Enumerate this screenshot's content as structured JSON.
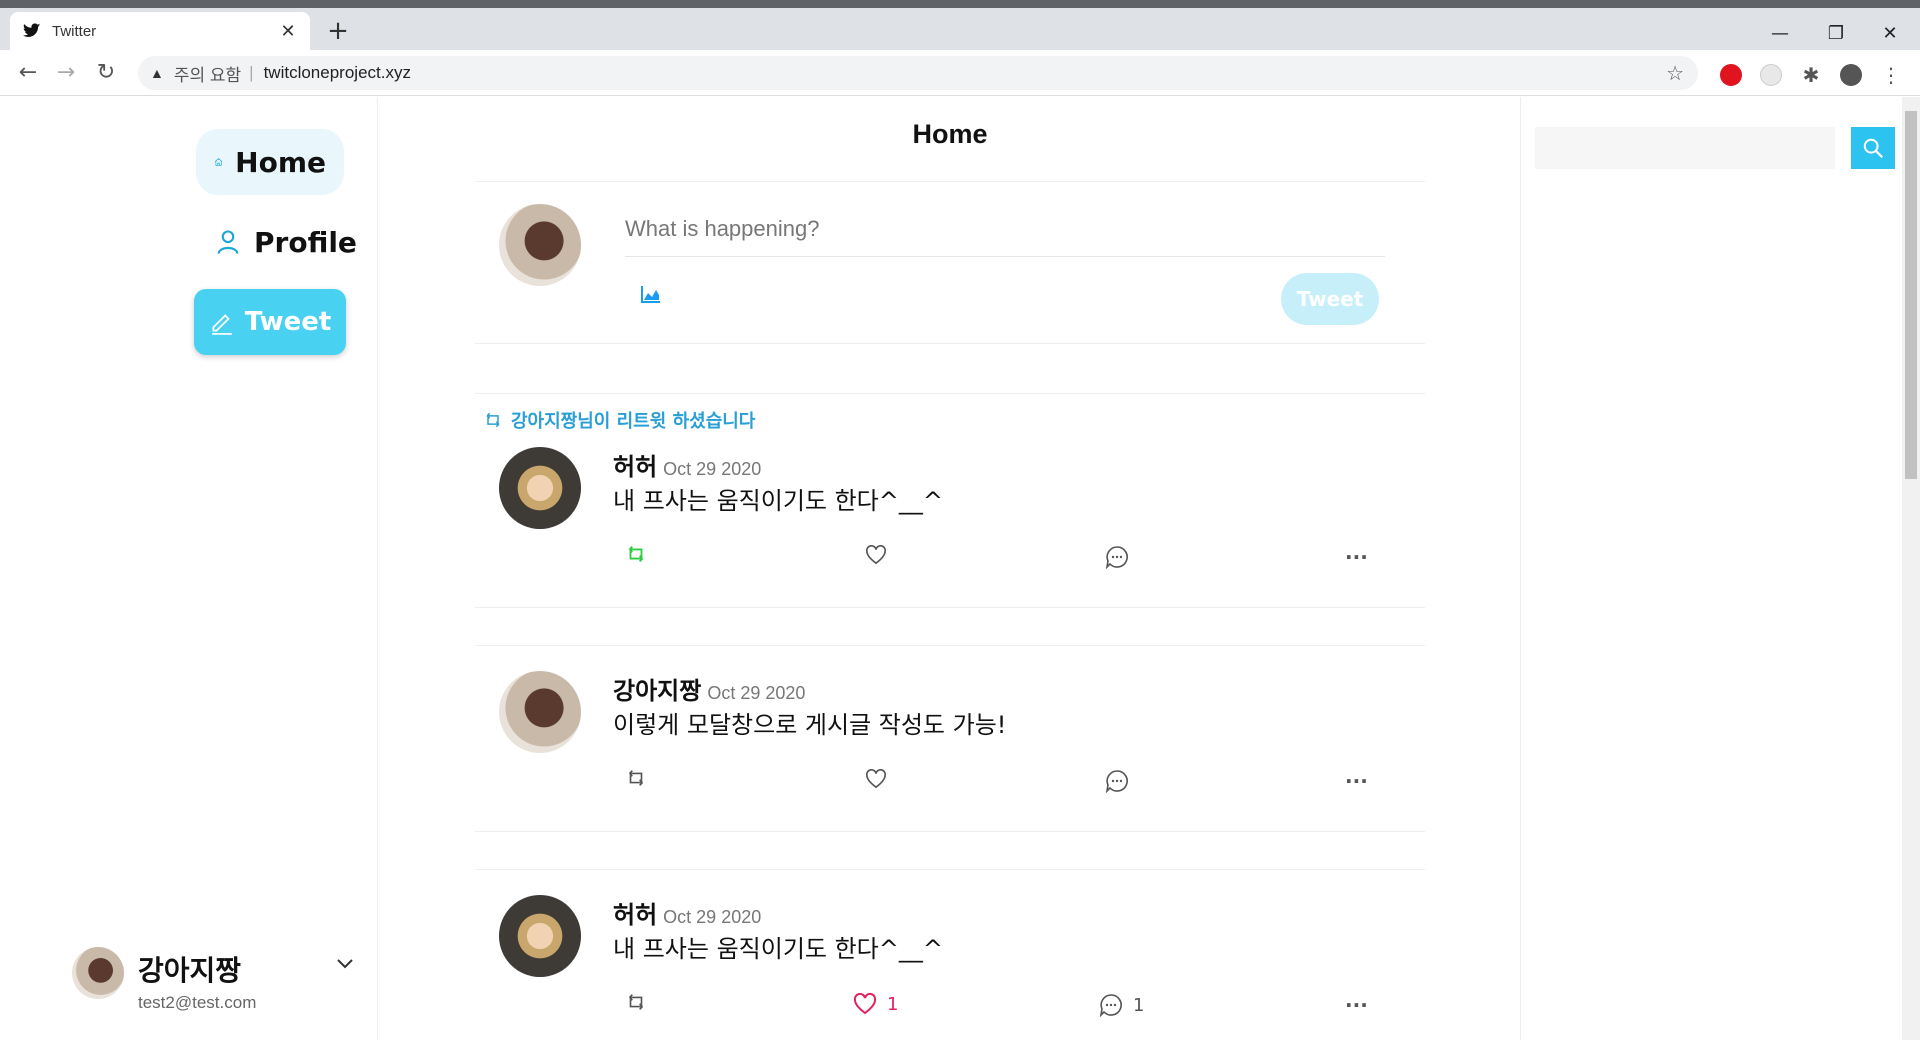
{
  "browser": {
    "tab_title": "Twitter",
    "close_symbol": "✕",
    "new_tab_symbol": "+",
    "warning_text": "주의 요함",
    "separator": "|",
    "url": "twitcloneproject.xyz",
    "win_minimize": "—",
    "win_restore": "❐",
    "win_close": "✕"
  },
  "sidebar": {
    "items": [
      {
        "label": "Home",
        "icon": "home-icon",
        "active": true
      },
      {
        "label": "Profile",
        "icon": "person-icon",
        "active": false
      }
    ],
    "tweet_button_label": "Tweet"
  },
  "account": {
    "name": "강아지짱",
    "email": "test2@test.com"
  },
  "main": {
    "title": "Home",
    "composer": {
      "placeholder": "What is happening?",
      "send_label": "Tweet"
    },
    "tweets": [
      {
        "retweet_note": "강아지짱님이 리트윗 하셨습니다",
        "author": "허허",
        "date": "Oct 29 2020",
        "text": "내 프사는 움직이기도 한다^__^",
        "avatar": "girl",
        "retweeted": true,
        "liked": false,
        "like_count": "",
        "reply_count": ""
      },
      {
        "retweet_note": "",
        "author": "강아지짱",
        "date": "Oct 29 2020",
        "text": "이렇게 모달창으로 게시글 작성도 가능!",
        "avatar": "dog",
        "retweeted": false,
        "liked": false,
        "like_count": "",
        "reply_count": ""
      },
      {
        "retweet_note": "",
        "author": "허허",
        "date": "Oct 29 2020",
        "text": "내 프사는 움직이기도 한다^__^",
        "avatar": "girl",
        "retweeted": false,
        "liked": true,
        "like_count": "1",
        "reply_count": "1"
      }
    ]
  },
  "colors": {
    "accent": "#48d1f0",
    "retweet_green": "#2ecc40",
    "like_pink": "#e0245e",
    "retweet_note": "#2a9fd6"
  }
}
